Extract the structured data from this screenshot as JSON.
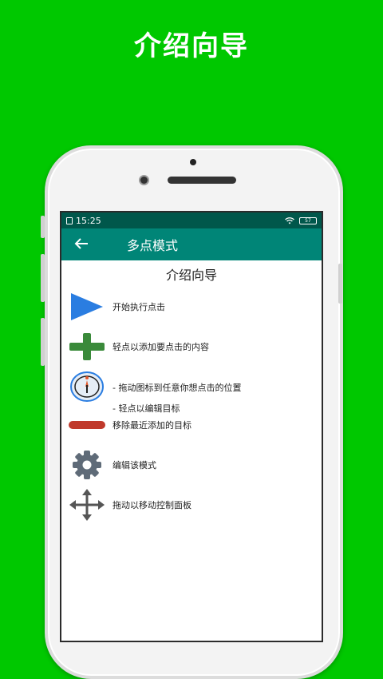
{
  "promo": {
    "title": "介绍向导"
  },
  "status": {
    "time": "15:25",
    "battery": "57"
  },
  "appbar": {
    "back_icon": "back-arrow-icon",
    "title": "多点模式"
  },
  "guide": {
    "title": "介绍向导",
    "items": [
      {
        "icon": "play-icon",
        "text": "开始执行点击"
      },
      {
        "icon": "plus-icon",
        "text": "轻点以添加要点击的内容"
      },
      {
        "icon": "target-icon",
        "line1": "- 拖动图标到任意你想点击的位置",
        "line2": "- 轻点以编辑目标"
      },
      {
        "icon": "minus-icon",
        "text": "移除最近添加的目标"
      },
      {
        "icon": "gear-icon",
        "text": "编辑该模式"
      },
      {
        "icon": "move-icon",
        "text": "拖动以移动控制面板"
      }
    ]
  },
  "colors": {
    "background": "#00c800",
    "appbar": "#008577",
    "statusbar": "#00574b",
    "play": "#2a7de1",
    "plus": "#3a8a3a",
    "minus": "#c0392b",
    "gear": "#5f6b78",
    "move": "#555555"
  }
}
